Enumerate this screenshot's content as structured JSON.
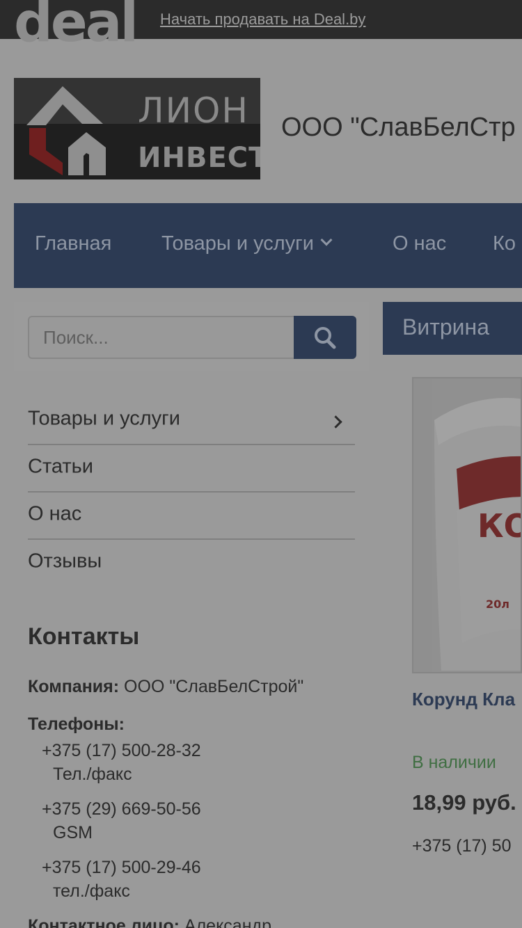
{
  "topbar": {
    "logo_text": "deal",
    "sell_link": "Начать продавать на Deal.by"
  },
  "header": {
    "logo_line1": "ЛИОН",
    "logo_line2": "ИНВЕСТ",
    "company_name": "ООО \"СлавБелСтр"
  },
  "nav": {
    "items": [
      {
        "label": "Главная"
      },
      {
        "label": "Товары и услуги"
      },
      {
        "label": "О нас"
      },
      {
        "label": "Ко"
      }
    ]
  },
  "search": {
    "placeholder": "Поиск..."
  },
  "sidebar": {
    "items": [
      {
        "label": "Товары и услуги"
      },
      {
        "label": "Статьи"
      },
      {
        "label": "О нас"
      },
      {
        "label": "Отзывы"
      }
    ]
  },
  "contacts": {
    "title": "Контакты",
    "company_label": "Компания:",
    "company_value": "ООО \"СлавБелСтрой\"",
    "phones_label": "Телефоны:",
    "phones": [
      {
        "number": "+375 (17) 500-28-32",
        "note": "Тел./факс"
      },
      {
        "number": "+375 (29) 669-50-56",
        "note": "GSM"
      },
      {
        "number": "+375 (17) 500-29-46",
        "note": "тел./факс"
      }
    ],
    "person_label": "Контактное лицо:",
    "person_value": "Александр"
  },
  "showcase": {
    "tab_label": "Витрина",
    "product": {
      "title": "Корунд Кла",
      "stock": "В наличии",
      "price": "18,99 руб.",
      "phone": "+375 (17) 50",
      "image_text": "КО",
      "image_sub": "20л"
    }
  },
  "colors": {
    "overlay_gray": "#9a9a9a",
    "nav_blue": "#2c3a53",
    "stock_green": "#3f6e42"
  }
}
